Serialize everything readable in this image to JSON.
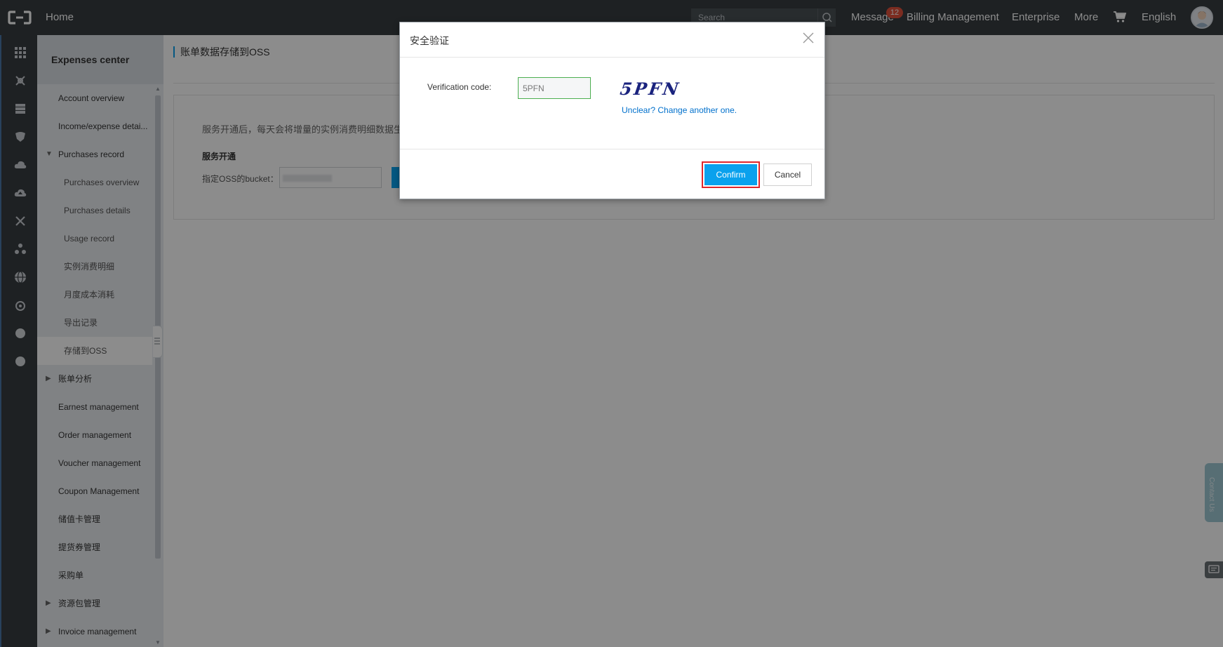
{
  "topbar": {
    "home": "Home",
    "search_placeholder": "Search",
    "message": "Message",
    "message_count": "12",
    "billing": "Billing Management",
    "enterprise": "Enterprise",
    "more": "More",
    "language": "English"
  },
  "sidebar": {
    "title": "Expenses center",
    "items": [
      {
        "label": "Account overview"
      },
      {
        "label": "Income/expense detai..."
      },
      {
        "label": "Purchases record"
      },
      {
        "label": "Purchases overview"
      },
      {
        "label": "Purchases details"
      },
      {
        "label": "Usage record"
      },
      {
        "label": "实例消费明细"
      },
      {
        "label": "月度成本消耗"
      },
      {
        "label": "导出记录"
      },
      {
        "label": "存储到OSS"
      },
      {
        "label": "账单分析"
      },
      {
        "label": "Earnest management"
      },
      {
        "label": "Order management"
      },
      {
        "label": "Voucher management"
      },
      {
        "label": "Coupon Management"
      },
      {
        "label": "储值卡管理"
      },
      {
        "label": "提货券管理"
      },
      {
        "label": "采购单"
      },
      {
        "label": "资源包管理"
      },
      {
        "label": "Invoice management"
      }
    ]
  },
  "main": {
    "page_title": "账单数据存储到OSS",
    "description": "服务开通后，每天会将增量的实例消费明细数据生",
    "section_title": "服务开通",
    "bucket_label": "指定OSS的bucket："
  },
  "dialog": {
    "title": "安全验证",
    "verification_label": "Verification code:",
    "verification_value": "5PFN",
    "captcha_text": "5PFN",
    "refresh_link": "Unclear? Change another one.",
    "confirm": "Confirm",
    "cancel": "Cancel"
  },
  "floating": {
    "contact": "Contact Us"
  },
  "colors": {
    "topbar_bg": "#373d41",
    "accent": "#0aa1ed",
    "highlight": "#e0262b",
    "sidebar_bg": "#eaedf1"
  },
  "icons": {
    "logo": "aliyun-logo-icon",
    "search": "search-icon",
    "cart": "cart-icon",
    "close": "close-icon"
  }
}
